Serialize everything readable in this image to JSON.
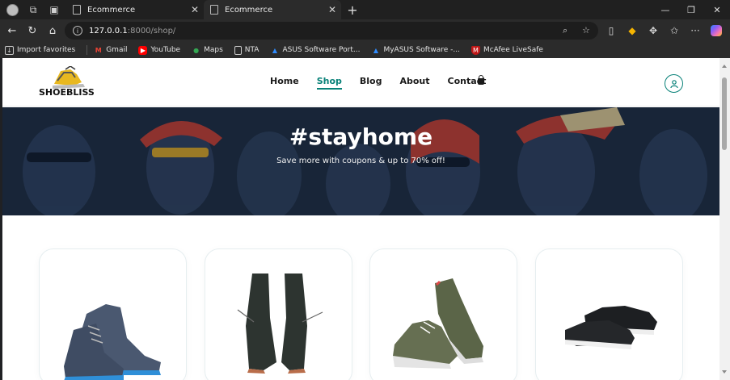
{
  "browser": {
    "tabs": [
      {
        "title": "Ecommerce"
      },
      {
        "title": "Ecommerce"
      }
    ],
    "url_host": "127.0.0.1",
    "url_rest": ":8000/shop/",
    "bookmarks": [
      {
        "label": "Import favorites",
        "icon": "import-icon"
      },
      {
        "label": "Gmail",
        "icon": "gmail-icon"
      },
      {
        "label": "YouTube",
        "icon": "youtube-icon"
      },
      {
        "label": "Maps",
        "icon": "maps-icon"
      },
      {
        "label": "NTA",
        "icon": "document-icon"
      },
      {
        "label": "ASUS Software Port...",
        "icon": "asus-icon"
      },
      {
        "label": "MyASUS Software -...",
        "icon": "asus-icon"
      },
      {
        "label": "McAfee LiveSafe",
        "icon": "mcafee-icon"
      }
    ]
  },
  "site": {
    "logo_text": "SHOEBLISS",
    "nav": [
      {
        "label": "Home"
      },
      {
        "label": "Shop"
      },
      {
        "label": "Blog"
      },
      {
        "label": "About"
      },
      {
        "label": "Contact"
      }
    ],
    "active_nav": "Shop",
    "hero_title": "#stayhome",
    "hero_subtitle": "Save more with coupons & up to 70% off!",
    "products": [
      {
        "image": "blue-suede-chukka-boots"
      },
      {
        "image": "black-leather-boots"
      },
      {
        "image": "olive-green-sneakers"
      },
      {
        "image": "black-slip-on-sneakers"
      }
    ]
  },
  "colors": {
    "accent": "#088178",
    "hero_bg": "#1c2a3d"
  }
}
